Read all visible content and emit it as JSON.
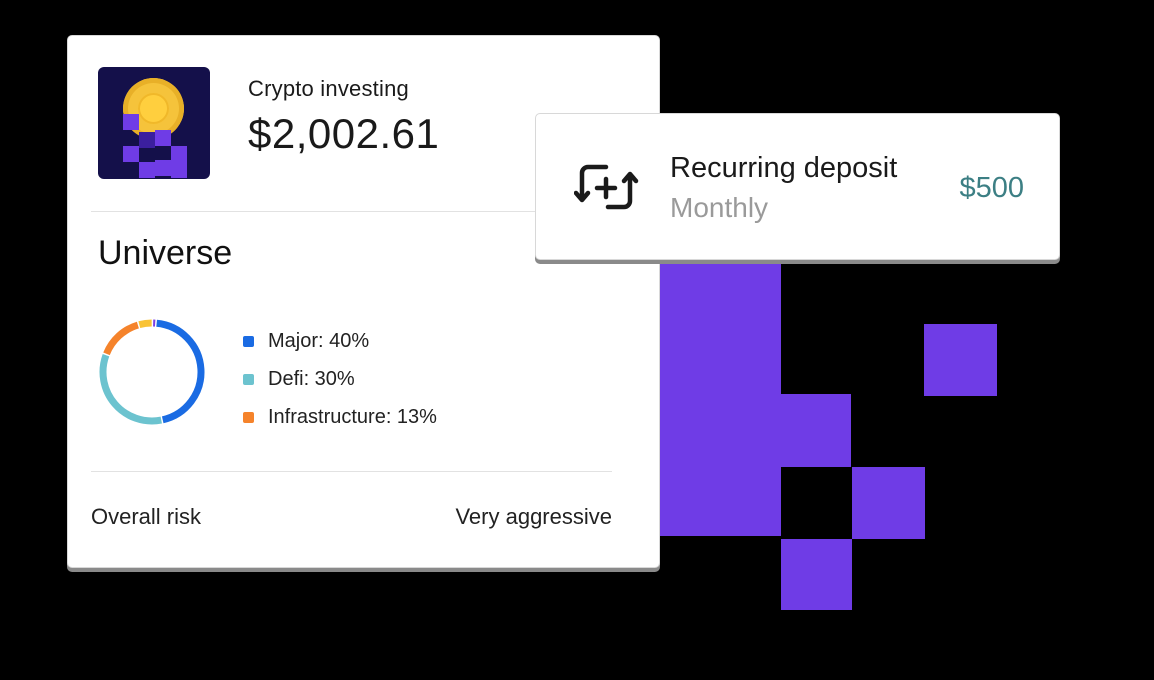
{
  "portfolio": {
    "title": "Crypto investing",
    "amount": "$2,002.61",
    "logo_icon": "crypto-coin-icon",
    "section_title": "Universe",
    "allocation": [
      {
        "label": "Major: 40%",
        "value": 40,
        "color": "#1a6be3"
      },
      {
        "label": "Defi: 30%",
        "value": 30,
        "color": "#6cc3cf"
      },
      {
        "label": "Infrastructure: 13%",
        "value": 13,
        "color": "#f5832b"
      }
    ],
    "allocation_other": [
      {
        "value": 4,
        "color": "#f9c335"
      },
      {
        "value": 1,
        "color": "#7b3fe4"
      }
    ],
    "risk_label": "Overall risk",
    "risk_value": "Very aggressive"
  },
  "deposit": {
    "icon": "recurring-deposit-icon",
    "title": "Recurring deposit",
    "frequency": "Monthly",
    "amount": "$500"
  },
  "colors": {
    "accent_purple": "#6f3ce6",
    "amount_teal": "#3c7f84"
  }
}
